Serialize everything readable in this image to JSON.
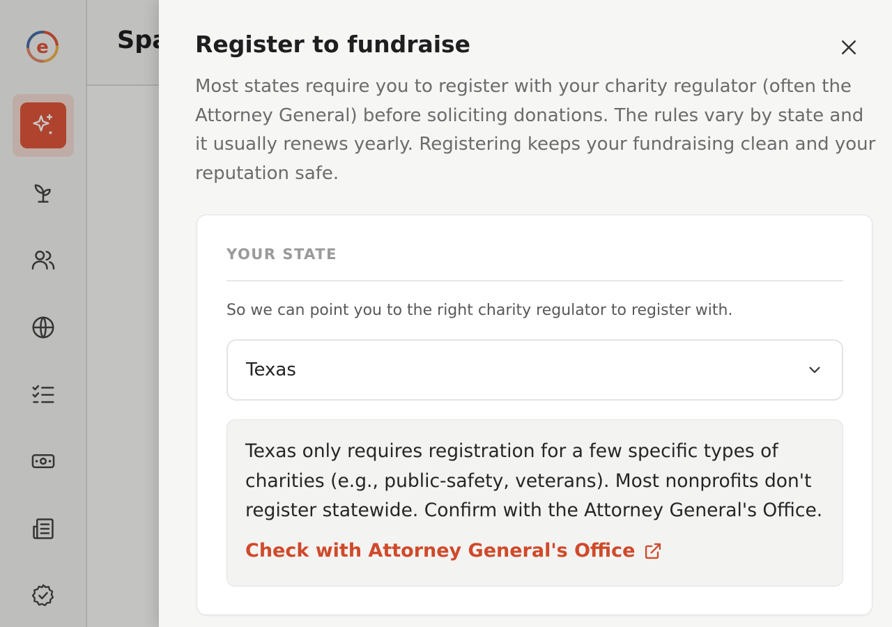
{
  "page": {
    "title": "Spa"
  },
  "sidebar": {
    "logo_letter": "e",
    "items": [
      {
        "icon": "sparkles-icon",
        "active": true
      },
      {
        "icon": "sprout-icon"
      },
      {
        "icon": "users-icon"
      },
      {
        "icon": "globe-icon"
      },
      {
        "icon": "checklist-icon"
      },
      {
        "icon": "banknote-icon"
      },
      {
        "icon": "newspaper-icon"
      },
      {
        "icon": "badge-check-icon"
      }
    ]
  },
  "drawer": {
    "title": "Register to fundraise",
    "description": "Most states require you to register with your charity regulator (often the Attorney General) before soliciting donations. The rules vary by state and it usually renews yearly. Registering keeps your fundraising clean and your reputation safe.",
    "section_label": "YOUR STATE",
    "section_help": "So we can point you to the right charity regulator to register with.",
    "state_select": {
      "value": "Texas"
    },
    "info": {
      "text": "Texas only requires registration for a few specific types of charities (e.g., public-safety, veterans). Most nonprofits don't register statewide. Confirm with the Attorney General's Office.",
      "link_label": "Check with Attorney General's Office"
    }
  },
  "colors": {
    "accent": "#e0573a",
    "link": "#cf4a2a"
  }
}
